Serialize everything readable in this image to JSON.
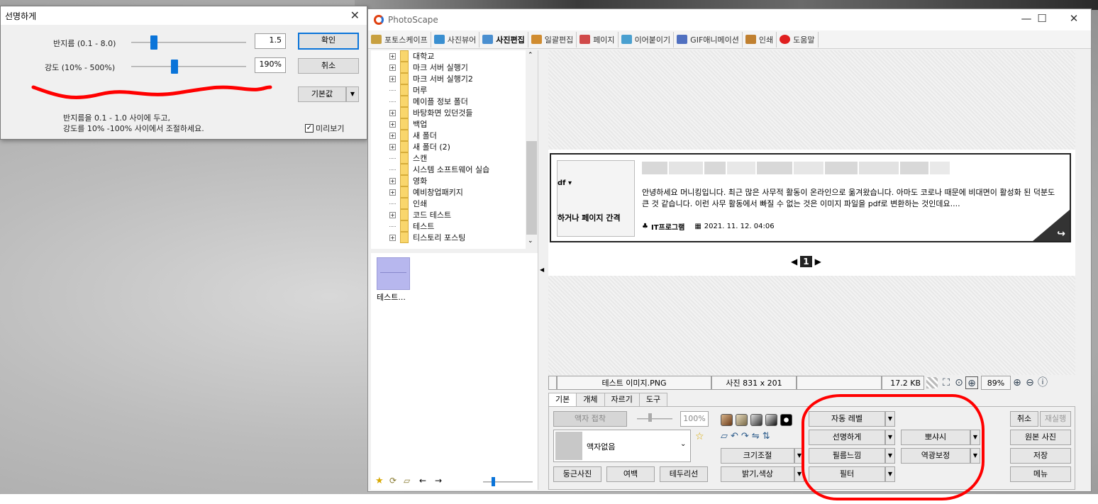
{
  "dialog": {
    "title": "선명하게",
    "radius_label": "반지름 (0.1 - 8.0)",
    "radius_value": "1.5",
    "radius_level": 0.18,
    "strength_label": "강도 (10% - 500%)",
    "strength_value": "190%",
    "strength_level": 0.37,
    "ok": "확인",
    "cancel": "취소",
    "default": "기본값",
    "hint_line1": "반지름을 0.1 - 1.0 사이에 두고,",
    "hint_line2": "강도를 10% -100% 사이에서 조절하세요.",
    "preview_label": "미리보기",
    "preview_checked": true
  },
  "app": {
    "title": "PhotoScape",
    "tabs": [
      {
        "label": "포토스케이프",
        "color": "#c8a040"
      },
      {
        "label": "사진뷰어",
        "color": "#3a8fd0"
      },
      {
        "label": "사진편집",
        "color": "#4a8fd0"
      },
      {
        "label": "일괄편집",
        "color": "#d08c30"
      },
      {
        "label": "페이지",
        "color": "#d04a4a"
      },
      {
        "label": "이어붙이기",
        "color": "#4aa0d0"
      },
      {
        "label": "GIF애니메이션",
        "color": "#5070c0"
      },
      {
        "label": "인쇄",
        "color": "#c08030"
      },
      {
        "label": "도움말",
        "color": "#e02020"
      }
    ],
    "active_tab": "사진편집"
  },
  "tree": [
    {
      "label": "대학교",
      "expandable": true
    },
    {
      "label": "마크 서버 실행기",
      "expandable": true
    },
    {
      "label": "마크 서버 실행기2",
      "expandable": true
    },
    {
      "label": "머루",
      "expandable": false
    },
    {
      "label": "메이플 정보 폴더",
      "expandable": false
    },
    {
      "label": "바탕화면 있던것들",
      "expandable": true
    },
    {
      "label": "백업",
      "expandable": true
    },
    {
      "label": "새 폴더",
      "expandable": true
    },
    {
      "label": "새 폴더 (2)",
      "expandable": true
    },
    {
      "label": "스캔",
      "expandable": false
    },
    {
      "label": "시스템 소프트웨어 실습",
      "expandable": false
    },
    {
      "label": "영화",
      "expandable": true
    },
    {
      "label": "예비창업패키지",
      "expandable": true
    },
    {
      "label": "인쇄",
      "expandable": false
    },
    {
      "label": "코드 테스트",
      "expandable": true
    },
    {
      "label": "테스트",
      "expandable": false
    },
    {
      "label": "티스토리 포스팅",
      "expandable": true
    }
  ],
  "thumbnail": {
    "label": "테스트..."
  },
  "card": {
    "thumb_line1": "df ▾",
    "thumb_line2": "하거나 페이지 간격",
    "text": "안녕하세요 머니킹입니다. 최근 많은 사무적 활동이 온라인으로 옮겨왔습니다. 아마도 코로나 때문에 비대면이 활성화 된 덕분도 큰 것 같습니다. 이런 사무 활동에서 빠질 수 없는 것은 이미지 파일을 pdf로 변환하는 것인데요....",
    "category": "IT프로그램",
    "date": "2021. 11. 12. 04:06",
    "page": "1"
  },
  "status": {
    "filename": "테스트 이미지.PNG",
    "dimensions": "사진 831 x 201",
    "filesize": "17.2 KB",
    "zoom": "89%"
  },
  "subtabs": [
    "기본",
    "개체",
    "자르기",
    "도구"
  ],
  "panel": {
    "frame_paste": "액자 접착",
    "frame_percent": "100%",
    "frame_select": "액자없음",
    "round_photo": "둥근사진",
    "margin": "여백",
    "border": "테두리선",
    "resize": "크기조절",
    "brightness": "밝기,색상",
    "auto_level": "자동 레벨",
    "sharpen": "선명하게",
    "film": "필름느낌",
    "filter": "필터",
    "bokeh": "뽀샤시",
    "backlight": "역광보정",
    "undo": "취소",
    "redo": "재실행",
    "original": "원본 사진",
    "save": "저장",
    "menu": "메뉴"
  }
}
